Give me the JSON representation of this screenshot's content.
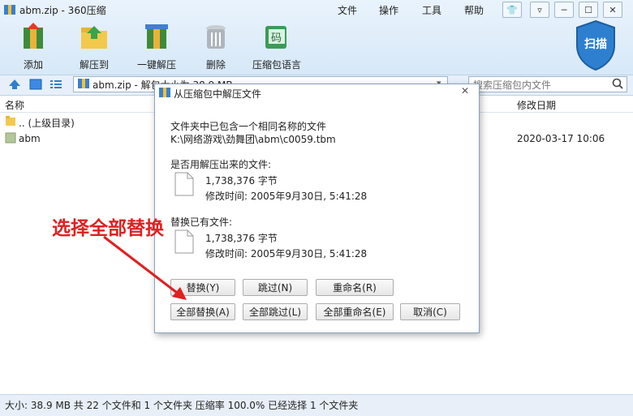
{
  "window": {
    "title": "abm.zip - 360压缩"
  },
  "menu": [
    "文件",
    "操作",
    "工具",
    "帮助"
  ],
  "toolbar": {
    "add": "添加",
    "extract_to": "解压到",
    "one_click": "一键解压",
    "delete": "删除",
    "cmt": "压缩包语言"
  },
  "scan": "扫描",
  "address": {
    "path": "abm.zip - 解包大小为 38.9 MB",
    "search_placeholder": "搜索压缩包内文件"
  },
  "columns": {
    "name": "名称",
    "modified": "修改日期"
  },
  "files": [
    {
      "name": ".. (上级目录)",
      "modified": ""
    },
    {
      "name": "abm",
      "modified": "2020-03-17 10:06"
    }
  ],
  "status": "大小: 38.9 MB 共 22 个文件和 1 个文件夹 压缩率 100.0% 已经选择 1 个文件夹",
  "dialog": {
    "title": "从压缩包中解压文件",
    "msg": "文件夹中已包含一个相同名称的文件",
    "path": "K:\\网络游戏\\劲舞团\\abm\\c0059.tbm",
    "replace_with_label": "是否用解压出来的文件:",
    "new_size": "1,738,376 字节",
    "new_time": "修改时间: 2005年9月30日, 5:41:28",
    "existing_label": "替换已有文件:",
    "old_size": "1,738,376 字节",
    "old_time": "修改时间: 2005年9月30日, 5:41:28",
    "buttons": {
      "replace": "替换(Y)",
      "skip": "跳过(N)",
      "rename": "重命名(R)",
      "replace_all": "全部替换(A)",
      "skip_all": "全部跳过(L)",
      "rename_all": "全部重命名(E)",
      "cancel": "取消(C)"
    }
  },
  "annotation": "选择全部替换"
}
